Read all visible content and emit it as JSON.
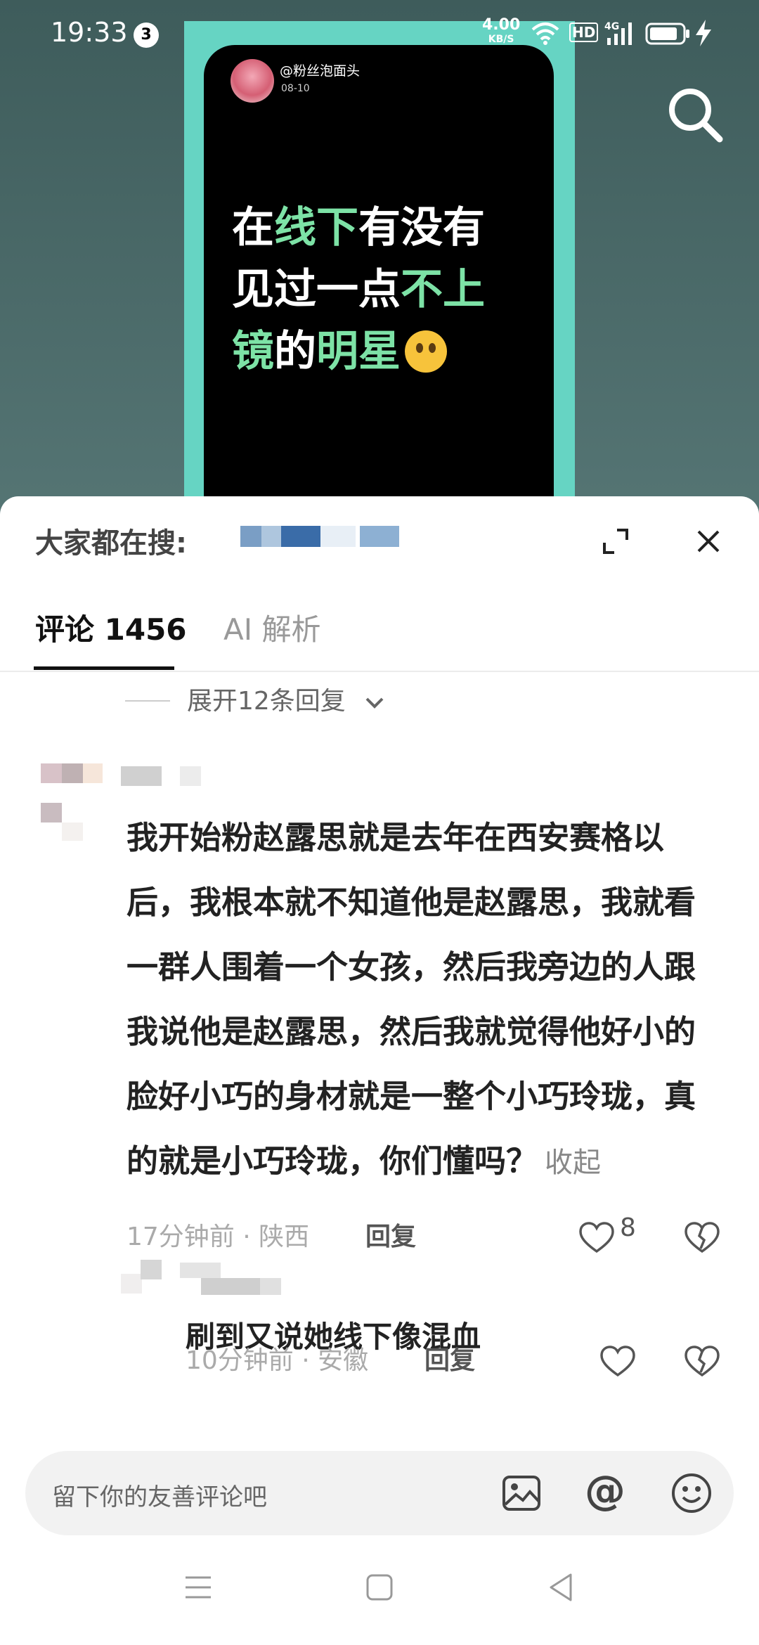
{
  "status_bar": {
    "time": "19:33",
    "notification_count": "3",
    "net_speed": "4.00",
    "net_unit": "KB/S",
    "hd_label": "HD",
    "network_type": "4G"
  },
  "video_card": {
    "username": "@粉丝泡面头",
    "date": "08-10",
    "caption_line1_a": "在",
    "caption_line1_b": "线下",
    "caption_line1_c": "有没有",
    "caption_line2_a": "见过一点",
    "caption_line2_b": "不上",
    "caption_line3_a": "镜",
    "caption_line3_b": "的",
    "caption_line3_c": "明星",
    "accent_color": "#7de2a6",
    "frame_color": "#66d4c3"
  },
  "sheet": {
    "trending_label": "大家都在搜:",
    "tabs": [
      {
        "label": "评论 1456",
        "active": true
      },
      {
        "label": "AI 解析",
        "active": false
      }
    ],
    "expand_replies": "展开12条回复",
    "comment": {
      "text": "我开始粉赵露思就是去年在西安赛格以后，我根本就不知道他是赵露思，我就看一群人围着一个女孩，然后我旁边的人跟我说他是赵露思，然后我就觉得他好小的脸好小巧的身材就是一整个小巧玲珑，真的就是小巧玲珑，你们懂吗？",
      "collapse_label": "收起",
      "time": "17分钟前",
      "location": "陕西",
      "reply_label": "回复",
      "likes": "8"
    },
    "reply": {
      "text": "刷到又说她线下像混血",
      "time": "10分钟前",
      "location": "安徽",
      "reply_label": "回复"
    },
    "input": {
      "placeholder": "留下你的友善评论吧",
      "at_symbol": "@"
    }
  }
}
